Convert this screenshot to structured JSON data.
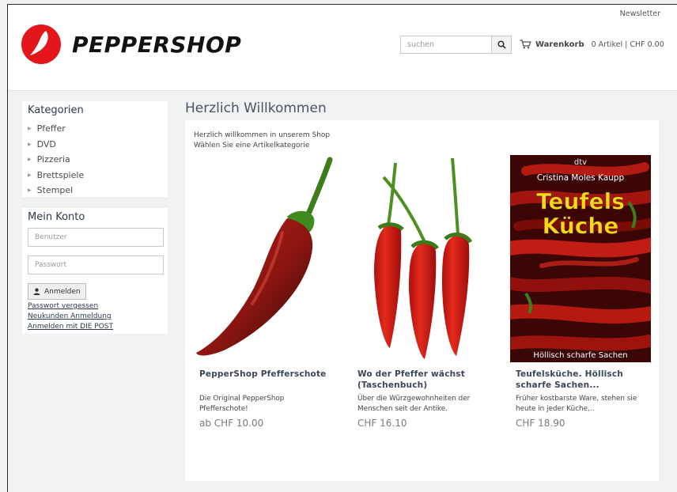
{
  "header": {
    "newsletter": "Newsletter",
    "brand": "PEPPERSHOP",
    "search_placeholder": "suchen",
    "cart_title": "Warenkorb",
    "cart_summary": "0 Artikel | CHF 0.00"
  },
  "colors": {
    "brand_red": "#e3171b",
    "text_dark": "#2d3a4d"
  },
  "sidebar": {
    "categories_title": "Kategorien",
    "categories": [
      "Pfeffer",
      "DVD",
      "Pizzeria",
      "Brettspiele",
      "Stempel"
    ],
    "account_title": "Mein Konto",
    "username_placeholder": "Benutzer",
    "password_placeholder": "Passwort",
    "login_label": "Anmelden",
    "links": [
      "Passwort vergessen",
      "Neukunden Anmeldung",
      "Anmelden mit DIE POST"
    ]
  },
  "main": {
    "title": "Herzlich Willkommen",
    "intro_line1": "Herzlich willkommen in unserem Shop",
    "intro_line2": "Wählen Sie eine Artikelkategorie",
    "products": [
      {
        "title": "PepperShop Pfefferschote",
        "desc": "Die Original PepperShop Pfefferschote!",
        "price": "ab CHF 10.00"
      },
      {
        "title": "Wo der Pfeffer wächst (Taschenbuch)",
        "desc": "Über die Würzgewohnheiten der Menschen seit der Antike.",
        "price": "CHF 16.10"
      },
      {
        "title": "Teufelsküche. Höllisch scharfe Sachen...",
        "desc": "Früher kostbarste Ware, stehen sie heute in jeder Küche,..",
        "price": "CHF 18.90",
        "cover": {
          "publisher": "dtv",
          "author": "Cristina Moles Kaupp",
          "title_line1": "Teufels",
          "title_line2": "Küche",
          "subtitle": "Höllisch scharfe Sachen"
        }
      }
    ]
  }
}
